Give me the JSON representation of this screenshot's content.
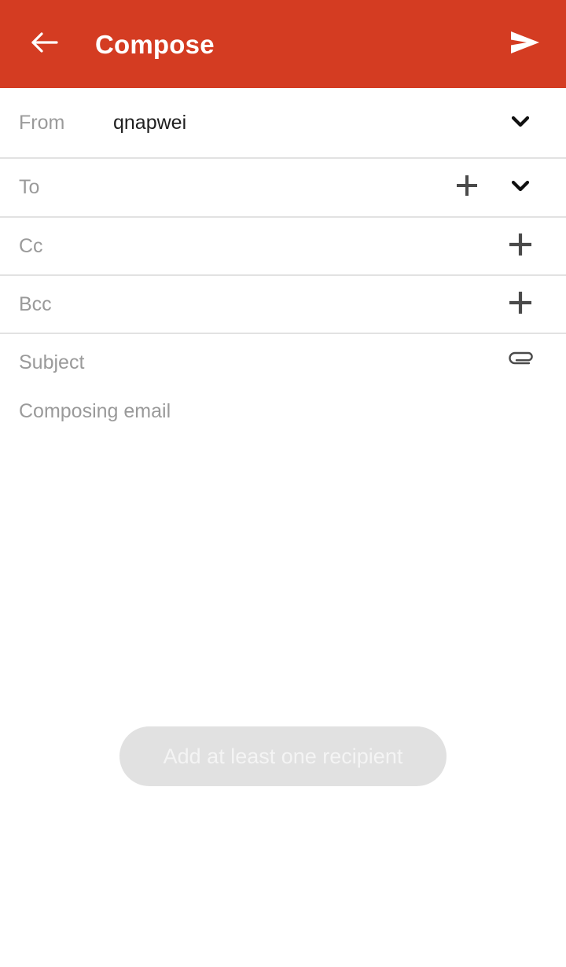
{
  "appbar": {
    "title": "Compose",
    "back_icon": "arrow-left-icon",
    "send_icon": "send-icon",
    "background_color": "#d43c22",
    "foreground_color": "#ffffff"
  },
  "fields": {
    "from": {
      "label": "From",
      "value": "qnapwei",
      "chevron_icon": "chevron-down-icon"
    },
    "to": {
      "label": "To",
      "value": "",
      "plus_icon": "plus-icon",
      "chevron_icon": "chevron-down-icon"
    },
    "cc": {
      "label": "Cc",
      "value": "",
      "plus_icon": "plus-icon"
    },
    "bcc": {
      "label": "Bcc",
      "value": "",
      "plus_icon": "plus-icon"
    },
    "subject": {
      "label": "Subject",
      "value": "",
      "attach_icon": "paperclip-icon"
    }
  },
  "body": {
    "placeholder": "Composing email",
    "value": ""
  },
  "toast": {
    "message": "Add at least one recipient",
    "background_color": "#e1e1e1",
    "text_color": "#f4f4f4"
  },
  "colors": {
    "accent": "#d43c22",
    "label_gray": "#9a9a9a",
    "value_dark": "#1f1f1f",
    "divider": "#e2e2e2",
    "icon_gray": "#4a4a4a",
    "icon_dark": "#101010"
  }
}
